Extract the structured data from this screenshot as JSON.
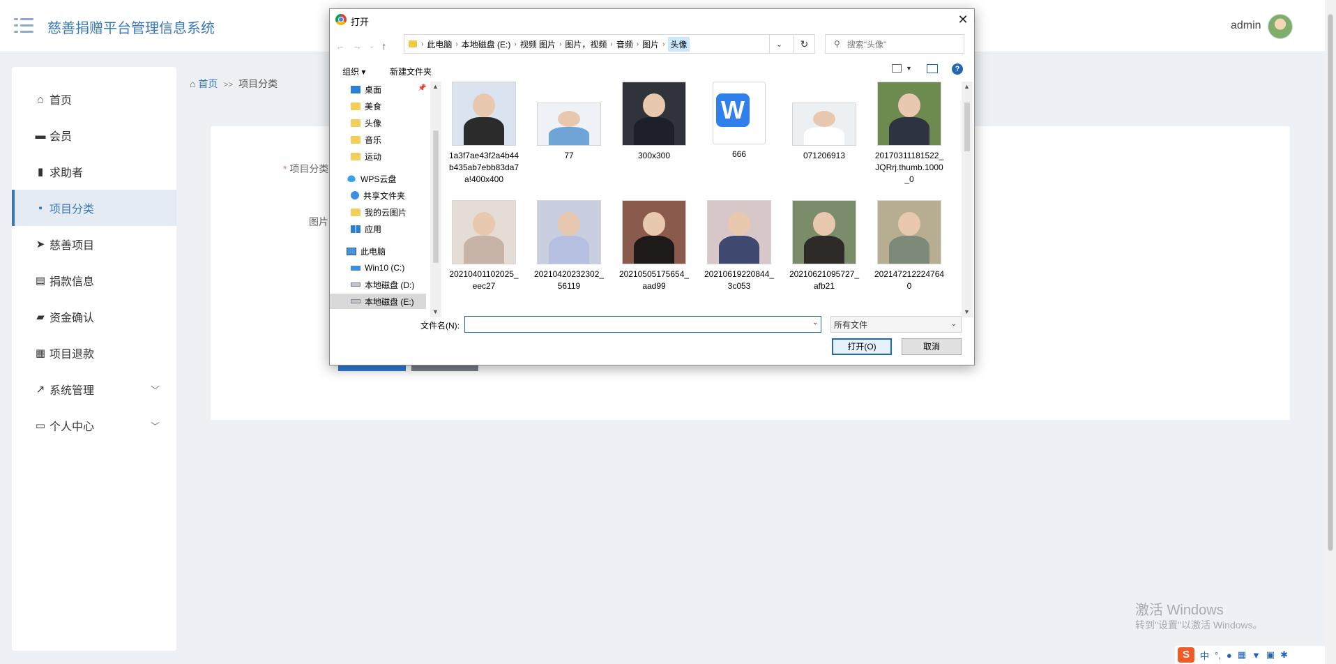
{
  "header": {
    "app_title": "慈善捐赠平台管理信息系统",
    "user_name": "admin"
  },
  "sidebar": {
    "items": [
      {
        "label": "首页",
        "icon": "home-icon"
      },
      {
        "label": "会员",
        "icon": "briefcase-icon"
      },
      {
        "label": "求助者",
        "icon": "bar-chart-icon"
      },
      {
        "label": "项目分类",
        "icon": "comment-icon",
        "active": true
      },
      {
        "label": "慈善项目",
        "icon": "send-icon"
      },
      {
        "label": "捐款信息",
        "icon": "clipboard-icon"
      },
      {
        "label": "资金确认",
        "icon": "ticket-icon"
      },
      {
        "label": "项目退款",
        "icon": "grid-icon"
      },
      {
        "label": "系统管理",
        "icon": "line-chart-icon",
        "expandable": true
      },
      {
        "label": "个人中心",
        "icon": "id-card-icon",
        "expandable": true
      }
    ]
  },
  "breadcrumb": {
    "home": "首页",
    "separator": ">>",
    "current": "项目分类"
  },
  "form": {
    "required_mark": "*",
    "category_label": "项目分类",
    "image_label": "图片"
  },
  "dialog": {
    "title": "打开",
    "close": "✕",
    "address": [
      "此电脑",
      "本地磁盘 (E:)",
      "视频 图片",
      "图片，视频",
      "音频",
      "图片",
      "头像"
    ],
    "search_placeholder": "搜索\"头像\"",
    "toolbar": {
      "organize": "组织 ▾",
      "new_folder": "新建文件夹",
      "help": "?"
    },
    "tree": [
      {
        "label": "桌面",
        "icon": "desktop-icon"
      },
      {
        "label": "美食",
        "icon": "folder-icon"
      },
      {
        "label": "头像",
        "icon": "folder-icon"
      },
      {
        "label": "音乐",
        "icon": "folder-icon"
      },
      {
        "label": "运动",
        "icon": "folder-icon"
      },
      {
        "label": "WPS云盘",
        "icon": "cloud-icon"
      },
      {
        "label": "共享文件夹",
        "icon": "share-icon"
      },
      {
        "label": "我的云图片",
        "icon": "folder-icon"
      },
      {
        "label": "应用",
        "icon": "apps-icon"
      },
      {
        "label": "此电脑",
        "icon": "pc-icon"
      },
      {
        "label": "Win10 (C:)",
        "icon": "windows-drive-icon"
      },
      {
        "label": "本地磁盘 (D:)",
        "icon": "drive-icon"
      },
      {
        "label": "本地磁盘 (E:)",
        "icon": "drive-icon"
      }
    ],
    "files": [
      {
        "name": "1a3f7ae43f2a4b44b435ab7ebb83da7a!400x400",
        "kind": "photo",
        "colors": [
          "#d9e4f0",
          "#2b2b2b"
        ]
      },
      {
        "name": "77",
        "kind": "photo-wide",
        "colors": [
          "#eef2f6",
          "#6fa4d6"
        ]
      },
      {
        "name": "300x300",
        "kind": "photo",
        "colors": [
          "#30343a",
          "#1d2029"
        ]
      },
      {
        "name": "666",
        "kind": "doc"
      },
      {
        "name": "071206913",
        "kind": "photo-wide",
        "colors": [
          "#edf0f3",
          "#ffffff"
        ]
      },
      {
        "name": "20170311181522_JQRrj.thumb.1000_0",
        "kind": "photo",
        "colors": [
          "#6d8a4f",
          "#2d3340"
        ]
      },
      {
        "name": "20210401102025_eec27",
        "kind": "photo",
        "colors": [
          "#e3ddd6",
          "#c7b3a8"
        ]
      },
      {
        "name": "20210420232302_56119",
        "kind": "photo",
        "colors": [
          "#c9cfe0",
          "#b6bfe0"
        ]
      },
      {
        "name": "20210505175654_aad99",
        "kind": "photo",
        "colors": [
          "#8a5b4c",
          "#1f1a1a"
        ]
      },
      {
        "name": "20210619220844_3c053",
        "kind": "photo",
        "colors": [
          "#d8c7c9",
          "#404a70"
        ]
      },
      {
        "name": "20210621095727_afb21",
        "kind": "photo",
        "colors": [
          "#7a8c6a",
          "#2e2a28"
        ]
      },
      {
        "name": "2021472122247640",
        "kind": "photo",
        "colors": [
          "#b7ad91",
          "#7d8a7a"
        ]
      }
    ],
    "filename_label": "文件名(N):",
    "filename_value": "",
    "filetype": "所有文件",
    "open_button": "打开(O)",
    "cancel_button": "取消"
  },
  "watermark": {
    "line1": "激活 Windows",
    "line2": "转到\"设置\"以激活 Windows。"
  },
  "ime": {
    "logo": "S",
    "mode": "中"
  },
  "colors": {
    "accent": "#3a78b5",
    "dialog_accent": "#2166b0"
  }
}
